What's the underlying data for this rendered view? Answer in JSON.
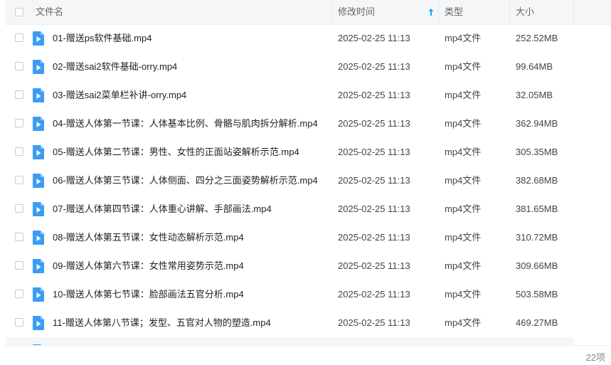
{
  "header": {
    "name_label": "文件名",
    "time_label": "修改时间",
    "type_label": "类型",
    "size_label": "大小"
  },
  "files": [
    {
      "name": "01-赠送ps软件基础.mp4",
      "time": "2025-02-25 11:13",
      "type": "mp4文件",
      "size": "252.52MB"
    },
    {
      "name": "02-赠送sai2软件基础-orry.mp4",
      "time": "2025-02-25 11:13",
      "type": "mp4文件",
      "size": "99.64MB"
    },
    {
      "name": "03-赠送sai2菜单栏补讲-orry.mp4",
      "time": "2025-02-25 11:13",
      "type": "mp4文件",
      "size": "32.05MB"
    },
    {
      "name": "04-赠送人体第一节课：人体基本比例、骨骼与肌肉拆分解析.mp4",
      "time": "2025-02-25 11:13",
      "type": "mp4文件",
      "size": "362.94MB"
    },
    {
      "name": "05-赠送人体第二节课：男性、女性的正面站姿解析示范.mp4",
      "time": "2025-02-25 11:13",
      "type": "mp4文件",
      "size": "305.35MB"
    },
    {
      "name": "06-赠送人体第三节课：人体侧面、四分之三面姿势解析示范.mp4",
      "time": "2025-02-25 11:13",
      "type": "mp4文件",
      "size": "382.68MB"
    },
    {
      "name": "07-赠送人体第四节课：人体重心讲解、手部画法.mp4",
      "time": "2025-02-25 11:13",
      "type": "mp4文件",
      "size": "381.65MB"
    },
    {
      "name": "08-赠送人体第五节课：女性动态解析示范.mp4",
      "time": "2025-02-25 11:13",
      "type": "mp4文件",
      "size": "310.72MB"
    },
    {
      "name": "09-赠送人体第六节课：女性常用姿势示范.mp4",
      "time": "2025-02-25 11:13",
      "type": "mp4文件",
      "size": "309.66MB"
    },
    {
      "name": "10-赠送人体第七节课：脸部画法五官分析.mp4",
      "time": "2025-02-25 11:13",
      "type": "mp4文件",
      "size": "503.58MB"
    },
    {
      "name": "11-赠送人体第八节课；发型、五官对人物的塑造.mp4",
      "time": "2025-02-25 11:13",
      "type": "mp4文件",
      "size": "469.27MB"
    }
  ],
  "footer": {
    "count": "22项"
  },
  "icons": {
    "file": "video-file-icon",
    "sort": "sort-ascending-icon"
  },
  "colors": {
    "accent": "#06a7ff",
    "header_bg": "#f5f6f7"
  }
}
